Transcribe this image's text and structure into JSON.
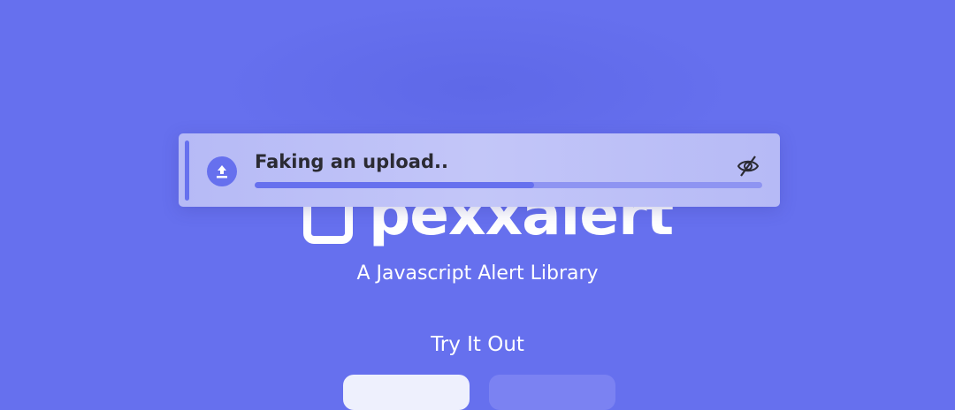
{
  "logo": {
    "text": "pexxalert"
  },
  "tagline": "A Javascript Alert Library",
  "try_heading": "Try It Out",
  "alert": {
    "title": "Faking an upload..",
    "progress_percent": 55,
    "icon": "upload-icon",
    "action_icon": "eye-off-icon"
  },
  "colors": {
    "background": "#6670ee",
    "alert_bg": "#bdc0f7",
    "accent": "#6670ee"
  }
}
